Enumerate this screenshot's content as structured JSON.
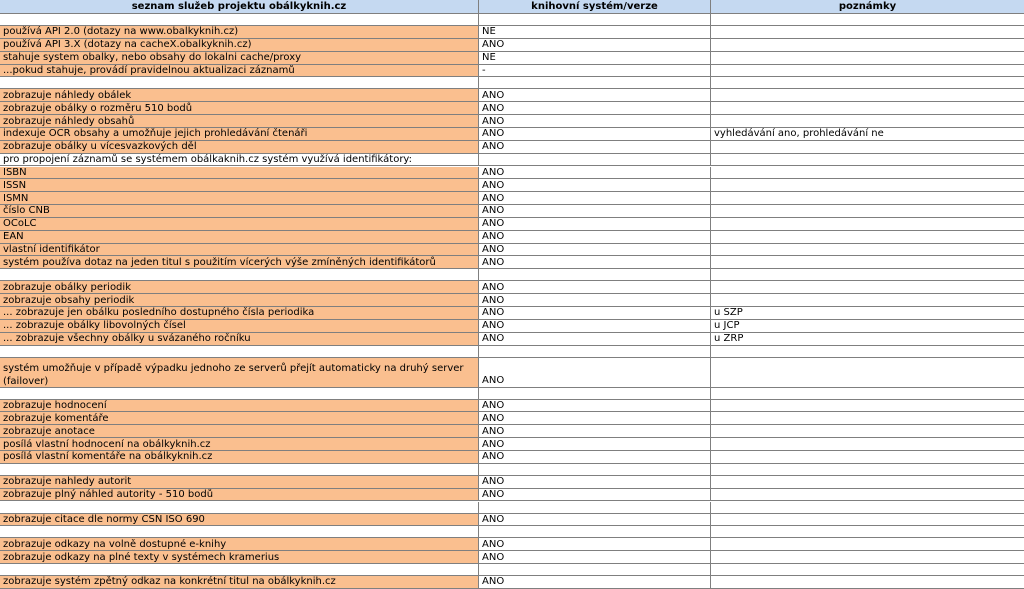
{
  "header": {
    "col1": "seznam služeb projektu obálkyknih.cz",
    "col2": "knihovní systém/verze",
    "col3": "poznámky"
  },
  "rows": [
    {
      "type": "blank"
    },
    {
      "label": "používá API  2.0 (dotazy na www.obalkyknih.cz)",
      "value": "NE",
      "note": ""
    },
    {
      "label": "používá API  3.X (dotazy na cacheX.obalkyknih.cz)",
      "value": "ANO",
      "note": ""
    },
    {
      "label": "stahuje system obalky, nebo obsahy do lokalni cache/proxy",
      "value": "NE",
      "note": ""
    },
    {
      "label": " ...pokud stahuje, provádí pravidelnou aktualizaci záznamů",
      "value": "-",
      "note": ""
    },
    {
      "type": "blank"
    },
    {
      "label": "zobrazuje náhledy obálek",
      "value": "ANO",
      "note": ""
    },
    {
      "label": "zobrazuje obálky o rozměru 510 bodů",
      "value": "ANO",
      "note": ""
    },
    {
      "label": "zobrazuje náhledy obsahů",
      "value": "ANO",
      "note": ""
    },
    {
      "label": "indexuje OCR obsahy a umožňuje jejich prohledávání čtenáři",
      "value": "ANO",
      "note": "vyhledávání ano, prohledávání ne"
    },
    {
      "label": "zobrazuje obálky u vícesvazkových děl",
      "value": "ANO",
      "note": ""
    },
    {
      "label": "pro propojení záznamů se systémem obálkaknih.cz  systém využívá identifikátory:",
      "value": "",
      "note": "",
      "plain": true
    },
    {
      "label": "ISBN",
      "value": "ANO",
      "note": ""
    },
    {
      "label": "ISSN",
      "value": "ANO",
      "note": ""
    },
    {
      "label": "ISMN",
      "value": "ANO",
      "note": ""
    },
    {
      "label": "číslo ČNB",
      "value": "ANO",
      "note": ""
    },
    {
      "label": "OCoLC",
      "value": "ANO",
      "note": ""
    },
    {
      "label": "EAN",
      "value": "ANO",
      "note": ""
    },
    {
      "label": "vlastní identifikátor",
      "value": "ANO",
      "note": ""
    },
    {
      "label": "systém používa dotaz na jeden titul s použitím vícerých výše zmíněných identifikátorů",
      "value": "ANO",
      "note": ""
    },
    {
      "type": "blank"
    },
    {
      "label": "zobrazuje obálky periodik",
      "value": "ANO",
      "note": ""
    },
    {
      "label": "zobrazuje obsahy periodik",
      "value": "ANO",
      "note": ""
    },
    {
      "label": " ... zobrazuje jen obálku posledního dostupného čísla periodika",
      "value": "ANO",
      "note": "u SZP"
    },
    {
      "label": " ... zobrazuje obálky libovolných čísel",
      "value": "ANO",
      "note": "u JCP"
    },
    {
      "label": " ... zobrazuje všechny obálky u svázaného ročníku",
      "value": "ANO",
      "note": "u ZRP"
    },
    {
      "type": "blank"
    },
    {
      "label": "systém umožňuje v případě výpadku jednoho ze serverů přejít automaticky na druhý server (failover)",
      "value": "ANO",
      "note": "",
      "tall": true
    },
    {
      "type": "blank"
    },
    {
      "label": "zobrazuje hodnocení",
      "value": "ANO",
      "note": ""
    },
    {
      "label": "zobrazuje komentáře",
      "value": "ANO",
      "note": ""
    },
    {
      "label": "zobrazuje anotace",
      "value": "ANO",
      "note": ""
    },
    {
      "label": "posílá vlastní hodnocení na obálkyknih.cz",
      "value": "ANO",
      "note": ""
    },
    {
      "label": "posílá vlastní komentáře na obálkyknih.cz",
      "value": "ANO",
      "note": ""
    },
    {
      "type": "blank"
    },
    {
      "label": "zobrazuje nahledy autorit",
      "value": "ANO",
      "note": ""
    },
    {
      "label": "zobrazuje plný náhled autority - 510 bodů",
      "value": "ANO",
      "note": ""
    },
    {
      "type": "blank"
    },
    {
      "label": "zobrazuje citace dle normy ČSN ISO 690",
      "value": "ANO",
      "note": ""
    },
    {
      "type": "blank"
    },
    {
      "label": "zobrazuje odkazy na volně dostupné e-knihy",
      "value": "ANO",
      "note": ""
    },
    {
      "label": "zobrazuje odkazy na plné texty v systémech kramerius",
      "value": "ANO",
      "note": ""
    },
    {
      "type": "blank"
    },
    {
      "label": "zobrazuje systém zpětný odkaz na konkrétní titul na obálkyknih.cz",
      "value": "ANO",
      "note": ""
    }
  ]
}
